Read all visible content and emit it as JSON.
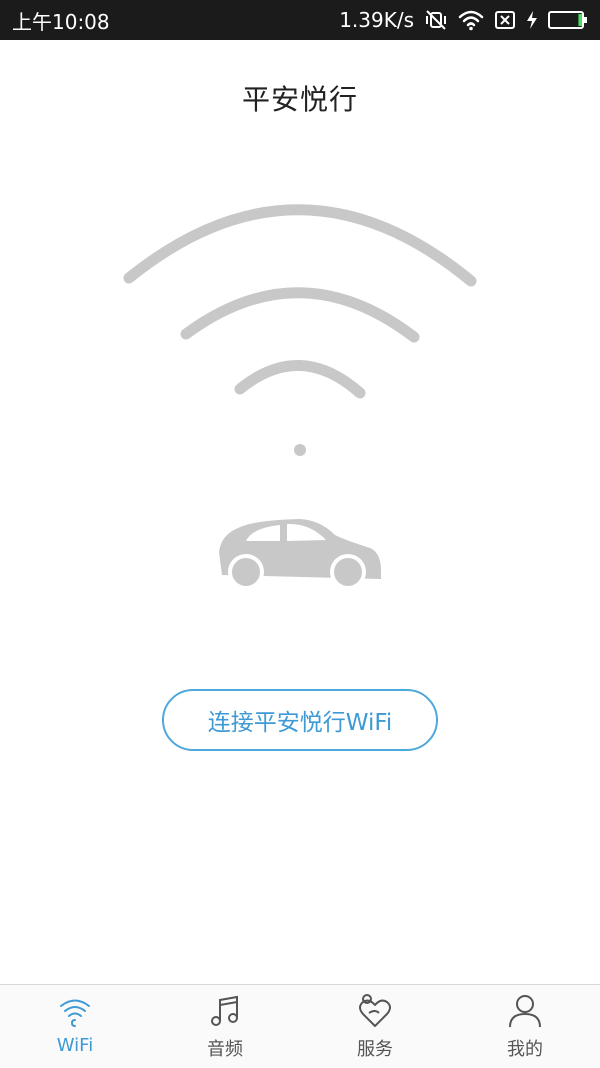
{
  "status_bar": {
    "time": "上午10:08",
    "net_speed": "1.39K/s",
    "icons": [
      "mute-vibrate-icon",
      "wifi-signal-icon",
      "no-sim-icon",
      "charging-icon",
      "battery-icon"
    ],
    "battery_level": 0.12
  },
  "page": {
    "title": "平安悦行"
  },
  "hero": {
    "icons": [
      "wifi-waves-icon",
      "car-icon"
    ],
    "color": "#c8c8c8"
  },
  "connect_button": {
    "label": "连接平安悦行WiFi",
    "color": "#4fa8dc"
  },
  "tab_bar": {
    "active_index": 0,
    "items": [
      {
        "label": "WiFi",
        "icon": "wifi-tab-icon"
      },
      {
        "label": "音频",
        "icon": "music-note-icon"
      },
      {
        "label": "服务",
        "icon": "heart-people-icon"
      },
      {
        "label": "我的",
        "icon": "user-icon"
      }
    ]
  },
  "colors": {
    "accent": "#3d9ad5",
    "status_bar_bg": "#1b1b1b",
    "battery_fill": "#4cd964"
  }
}
